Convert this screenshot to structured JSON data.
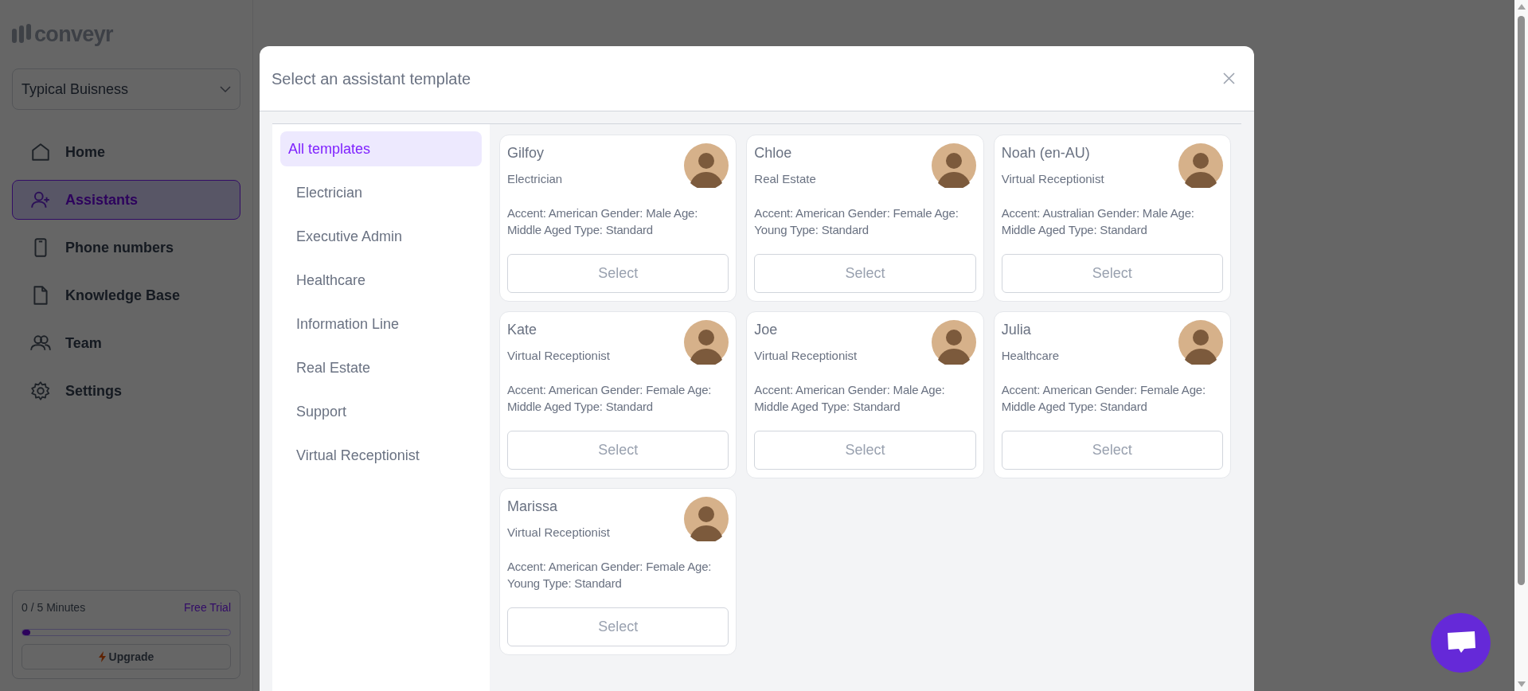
{
  "sidebar": {
    "logo": "conveyr",
    "business": "Typical Buisness",
    "items": [
      {
        "label": "Home",
        "kind": "home",
        "selected": false
      },
      {
        "label": "Assistants",
        "kind": "user-plus",
        "selected": true
      },
      {
        "label": "Phone numbers",
        "kind": "phone",
        "selected": false
      },
      {
        "label": "Knowledge Base",
        "kind": "file",
        "selected": false
      },
      {
        "label": "Team",
        "kind": "team",
        "selected": false
      },
      {
        "label": "Settings",
        "kind": "gear",
        "selected": false
      }
    ],
    "usage": {
      "minutes": "0 / 5 Minutes",
      "plan": "Free Trial",
      "level": 0.04,
      "upgrade": "Upgrade"
    }
  },
  "modal": {
    "title": "Select an assistant template",
    "categories": [
      {
        "label": "All templates",
        "selected": true
      },
      {
        "label": "Electrician",
        "selected": false
      },
      {
        "label": "Executive Admin",
        "selected": false
      },
      {
        "label": "Healthcare",
        "selected": false
      },
      {
        "label": "Information Line",
        "selected": false
      },
      {
        "label": "Real Estate",
        "selected": false
      },
      {
        "label": "Support",
        "selected": false
      },
      {
        "label": "Virtual Receptionist",
        "selected": false
      }
    ],
    "templates": [
      {
        "name": "Gilfoy",
        "role": "Electrician",
        "details": "Accent: American Gender: Male Age: Middle Aged Type: Standard",
        "button": "Select"
      },
      {
        "name": "Chloe",
        "role": "Real Estate",
        "details": "Accent: American Gender: Female Age: Young Type: Standard",
        "button": "Select"
      },
      {
        "name": "Noah (en-AU)",
        "role": "Virtual Receptionist",
        "details": "Accent: Australian Gender: Male Age: Middle Aged Type: Standard",
        "button": "Select"
      },
      {
        "name": "Kate",
        "role": "Virtual Receptionist",
        "details": "Accent: American Gender: Female Age: Middle Aged Type: Standard",
        "button": "Select"
      },
      {
        "name": "Joe",
        "role": "Virtual Receptionist",
        "details": "Accent: American Gender: Male Age: Middle Aged Type: Standard",
        "button": "Select"
      },
      {
        "name": "Julia",
        "role": "Healthcare",
        "details": "Accent: American Gender: Female Age: Middle Aged Type: Standard",
        "button": "Select"
      },
      {
        "name": "Marissa",
        "role": "Virtual Receptionist",
        "details": "Accent: American Gender: Female Age: Young Type: Standard",
        "button": "Select"
      }
    ]
  }
}
